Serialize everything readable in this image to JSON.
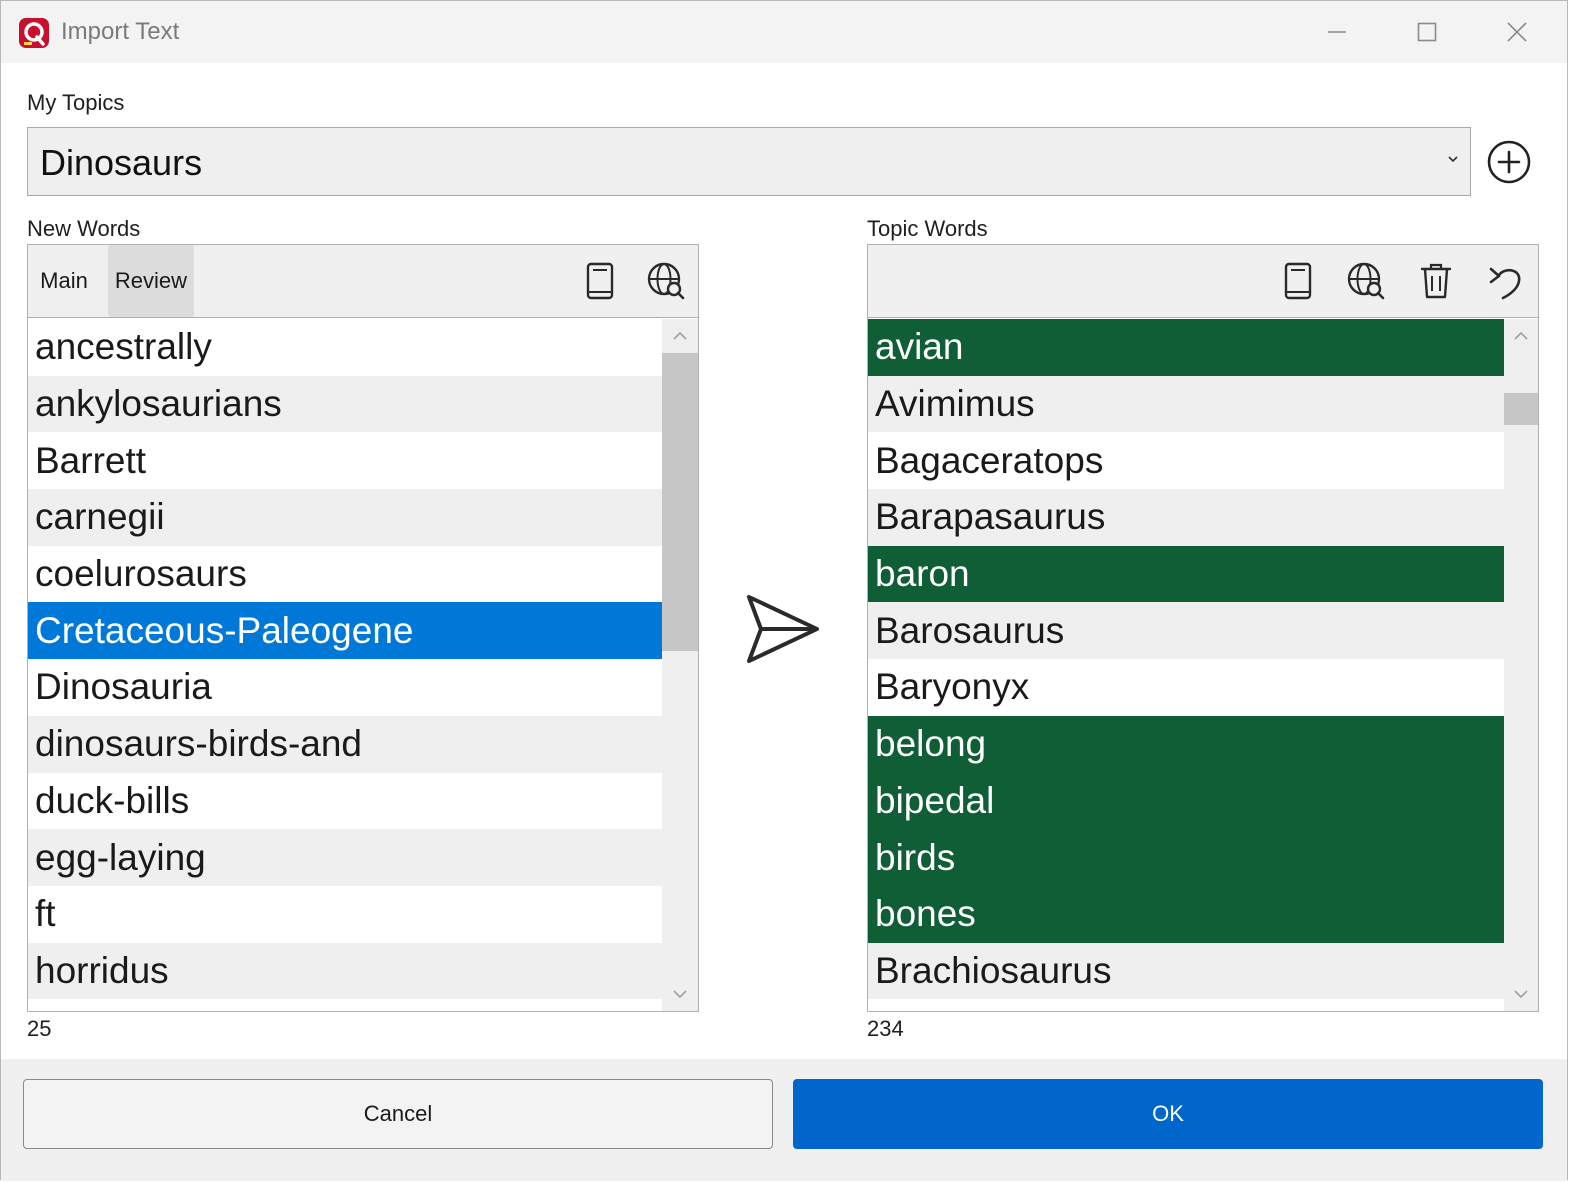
{
  "window": {
    "title": "Import Text",
    "accent": "#c8102e"
  },
  "topics": {
    "label": "My Topics",
    "selected": "Dinosaurs"
  },
  "new_words": {
    "label": "New Words",
    "tabs": [
      "Main",
      "Review"
    ],
    "active_tab": "Review",
    "items": [
      "ancestrally",
      "ankylosaurians",
      "Barrett",
      "carnegii",
      "coelurosaurs",
      "Cretaceous-Paleogene",
      "Dinosauria",
      "dinosaurs-birds-and",
      "duck-bills",
      "egg-laying",
      "ft",
      "horridus"
    ],
    "selected_item": "Cretaceous-Paleogene",
    "count": "25"
  },
  "topic_words": {
    "label": "Topic Words",
    "items": [
      {
        "text": "avian",
        "highlighted": true
      },
      {
        "text": "Avimimus",
        "highlighted": false
      },
      {
        "text": "Bagaceratops",
        "highlighted": false
      },
      {
        "text": "Barapasaurus",
        "highlighted": false
      },
      {
        "text": "baron",
        "highlighted": true
      },
      {
        "text": "Barosaurus",
        "highlighted": false
      },
      {
        "text": "Baryonyx",
        "highlighted": false
      },
      {
        "text": "belong",
        "highlighted": true
      },
      {
        "text": "bipedal",
        "highlighted": true
      },
      {
        "text": "birds",
        "highlighted": true
      },
      {
        "text": "bones",
        "highlighted": true
      },
      {
        "text": "Brachiosaurus",
        "highlighted": false
      }
    ],
    "count": "234"
  },
  "colors": {
    "selection": "#0078d7",
    "highlight": "#0f5e36",
    "primary_button": "#0066cc"
  },
  "buttons": {
    "cancel": "Cancel",
    "ok": "OK"
  },
  "icons": {
    "window_controls": [
      "minimize-icon",
      "maximize-icon",
      "close-icon"
    ],
    "new_words_tools": [
      "dictionary-icon",
      "web-search-icon"
    ],
    "topic_words_tools": [
      "dictionary-icon",
      "web-search-icon",
      "trash-icon",
      "undo-icon"
    ],
    "transfer": "send-arrow-icon",
    "add_topic": "plus-circle-icon"
  }
}
